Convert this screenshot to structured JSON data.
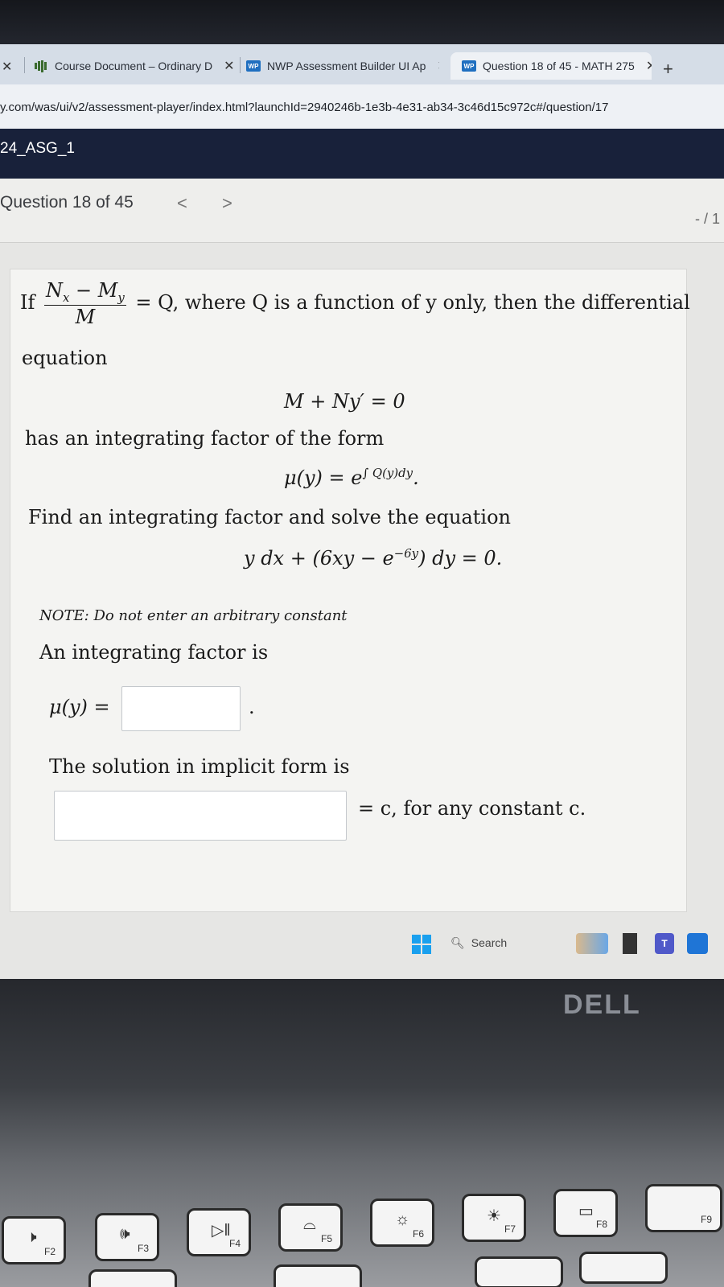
{
  "browser": {
    "tabs": [
      {
        "label": "Course Document – Ordinary D",
        "icon": "chart-bars-icon"
      },
      {
        "label": "NWP Assessment Builder UI Ap",
        "icon": "wp-icon"
      },
      {
        "label": "Question 18 of 45 - MATH 275",
        "icon": "wp-icon",
        "active": true
      }
    ],
    "url": "y.com/was/ui/v2/assessment-player/index.html?launchId=2940246b-1e3b-4e31-ab34-3c46d15c972c#/question/17"
  },
  "course": {
    "title": "24_ASG_1"
  },
  "question_nav": {
    "label": "Question 18 of 45",
    "prev": "<",
    "next": ">",
    "score": "- / 1"
  },
  "question": {
    "intro_if": "If",
    "where_text": "= Q, where Q is a function of y only, then the differential",
    "equation_word": "equation",
    "de": "M + Ny′ = 0",
    "has_factor": "has an integrating factor of the form",
    "find_text": "Find an integrating factor and solve the equation",
    "note": "NOTE: Do not enter an arbitrary constant",
    "factor_is": "An integrating factor is",
    "mu_label": "μ(y) =",
    "solution_label": "The solution in implicit form is",
    "solution_suffix": "= c, for any constant c."
  },
  "answers": {
    "mu": "",
    "solution": ""
  },
  "taskbar": {
    "search": "Search"
  },
  "brand": "DELL",
  "keys": [
    "F2",
    "F3",
    "F4",
    "F5",
    "F6",
    "F7",
    "F8",
    "F9"
  ]
}
